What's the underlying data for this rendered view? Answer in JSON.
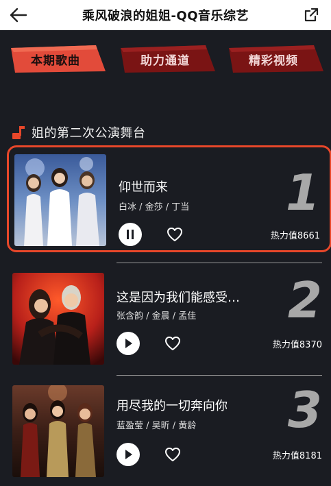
{
  "header": {
    "title": "乘风破浪的姐姐-QQ音乐综艺",
    "back_icon": "arrow-left-icon",
    "share_icon": "share-external-icon"
  },
  "tabs": [
    {
      "label": "本期歌曲",
      "active": true
    },
    {
      "label": "助力通道",
      "active": false
    },
    {
      "label": "精彩视频",
      "active": false
    }
  ],
  "section": {
    "title": "姐的第二次公演舞台",
    "icon": "music-note-icon"
  },
  "songs": [
    {
      "title": "仰世而来",
      "artists": "白冰 / 金莎 / 丁当",
      "rank": "1",
      "heat": "热力值8661",
      "state": "playing",
      "highlighted": true
    },
    {
      "title": "这是因为我们能感受…",
      "artists": "张含韵 / 金晨 / 孟佳",
      "rank": "2",
      "heat": "热力值8370",
      "state": "paused",
      "highlighted": false
    },
    {
      "title": "用尽我的一切奔向你",
      "artists": "蓝盈莹 / 吴昕 / 黄龄",
      "rank": "3",
      "heat": "热力值8181",
      "state": "paused",
      "highlighted": false
    }
  ],
  "colors": {
    "background": "#1a1c22",
    "accent": "#e8472a",
    "tab_active": "#e24b3a",
    "tab_inactive": "#7a1414",
    "rank": "#a8a8a8"
  }
}
